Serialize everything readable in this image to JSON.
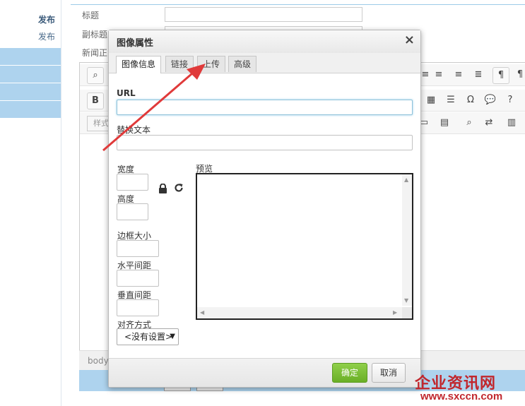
{
  "sidebar": {
    "links": [
      "发布",
      "发布"
    ]
  },
  "form": {
    "title_label": "标题",
    "subtitle_label": "副标题",
    "body_label": "新闻正"
  },
  "editor": {
    "style_combo": "样式",
    "status_path": "body",
    "toolbar_icons": [
      "find-icon",
      "align-center-icon",
      "align-right-icon",
      "justify-icon",
      "ltr-icon",
      "rtl-icon",
      "bold-icon",
      "table-icon",
      "horizontal-rule-icon",
      "special-char-icon",
      "smiley-icon",
      "about-icon",
      "page-icon",
      "template-icon",
      "search-icon",
      "replace-icon",
      "paste-icon"
    ]
  },
  "dialog": {
    "title": "图像属性",
    "close": "×",
    "tabs": [
      {
        "label": "图像信息",
        "active": true
      },
      {
        "label": "链接",
        "active": false
      },
      {
        "label": "上传",
        "active": false
      },
      {
        "label": "高级",
        "active": false
      }
    ],
    "url_label": "URL",
    "url_value": "",
    "alt_label": "替换文本",
    "alt_value": "",
    "width_label": "宽度",
    "height_label": "高度",
    "border_label": "边框大小",
    "hspace_label": "水平间距",
    "vspace_label": "垂直间距",
    "align_label": "对齐方式",
    "align_value": "<没有设置>",
    "preview_label": "预览",
    "ok_label": "确定",
    "cancel_label": "取消"
  },
  "watermark": {
    "name": "企业资讯网",
    "url": "www.sxccn.com"
  },
  "colors": {
    "ok_green": "#6aaf26",
    "sidebar_blue": "#aed3ee",
    "arrow_red": "#e03a3a",
    "watermark_red": "#c1272d"
  }
}
